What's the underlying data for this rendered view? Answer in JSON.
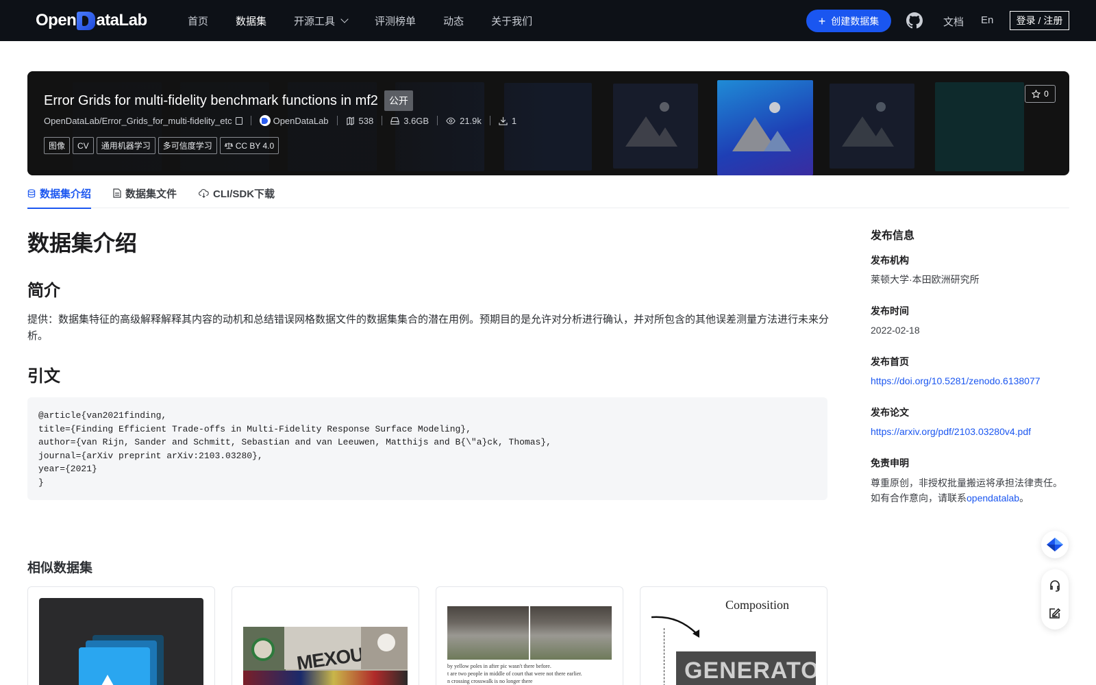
{
  "nav": {
    "logo_text_left": "Open",
    "logo_text_right": "ataLab",
    "links": [
      {
        "label": "首页"
      },
      {
        "label": "数据集",
        "active": true
      },
      {
        "label": "开源工具",
        "has_dropdown": true
      },
      {
        "label": "评测榜单"
      },
      {
        "label": "动态"
      },
      {
        "label": "关于我们"
      }
    ],
    "create_button": "创建数据集",
    "docs": "文档",
    "language": "En",
    "login": "登录 / 注册",
    "icons": {
      "github": "github-icon",
      "plus": "plus-icon",
      "chevron": "chevron-down-icon"
    }
  },
  "dataset": {
    "title": "Error Grids for multi-fidelity benchmark functions in mf2",
    "visibility": "公开",
    "repo": "OpenDataLab/Error_Grids_for_multi-fidelity_etc",
    "org": "OpenDataLab",
    "files_count": "538",
    "size": "3.6GB",
    "views": "21.9k",
    "downloads": "1",
    "tags": [
      "图像",
      "CV",
      "通用机器学习",
      "多可信度学习"
    ],
    "license": "CC BY 4.0",
    "stars": "0"
  },
  "tabs": [
    {
      "label": "数据集介绍",
      "active": true,
      "icon": "database-icon"
    },
    {
      "label": "数据集文件",
      "icon": "file-icon"
    },
    {
      "label": "CLI/SDK下载",
      "icon": "cloud-download-icon"
    }
  ],
  "content": {
    "heading": "数据集介绍",
    "intro_heading": "简介",
    "intro_text": "提供：数据集特征的高级解释解释其内容的动机和总结错误网格数据文件的数据集集合的潜在用例。预期目的是允许对分析进行确认，并对所包含的其他误差测量方法进行未来分析。",
    "citation_heading": "引文",
    "citation": "@article{van2021finding,\ntitle={Finding Efficient Trade-offs in Multi-Fidelity Response Surface Modeling},\nauthor={van Rijn, Sander and Schmitt, Sebastian and van Leeuwen, Matthijs and B{\\\"a}ck, Thomas},\njournal={arXiv preprint arXiv:2103.03280},\nyear={2021}\n}",
    "similar_heading": "相似数据集",
    "card4_text": "Composition",
    "card4_banner": "GENERATO",
    "card3_caption": "by yellow poles in after pic wasn't there before.\nt are two people in middle of court that were not there earlier.\nn crossing crosswalk is no longer there",
    "card2_text": "MEXOUT"
  },
  "sidebar": {
    "title": "发布信息",
    "org_label": "发布机构",
    "org_value": "莱顿大学·本田欧洲研究所",
    "date_label": "发布时间",
    "date_value": "2022-02-18",
    "homepage_label": "发布首页",
    "homepage_value": "https://doi.org/10.5281/zenodo.6138077",
    "paper_label": "发布论文",
    "paper_value": "https://arxiv.org/pdf/2103.03280v4.pdf",
    "disclaimer_label": "免责申明",
    "disclaimer_text": "尊重原创，非授权批量搬运将承担法律责任。如有合作意向，请联系",
    "disclaimer_link": "opendatalab",
    "disclaimer_end": "。"
  },
  "colors": {
    "accent": "#1a56f0",
    "nav_bg": "#0d1117",
    "banner_bg": "#121212"
  }
}
